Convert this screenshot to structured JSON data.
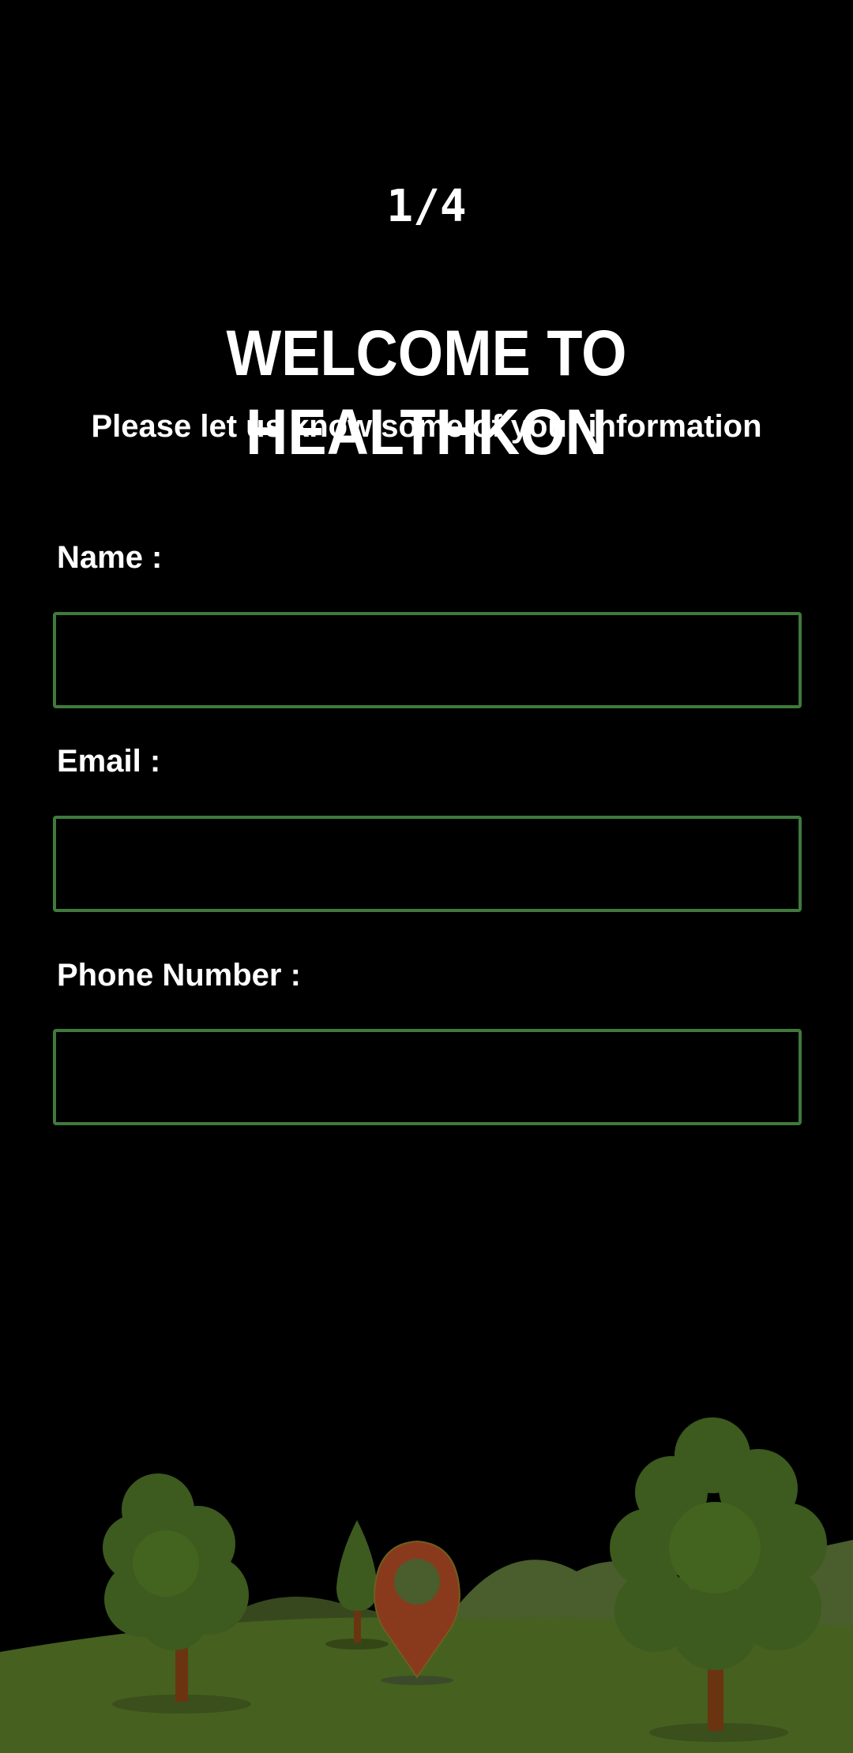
{
  "onboarding": {
    "step_indicator": "1/4",
    "title": "WELCOME TO HEALTHKON",
    "subtitle": "Please let us know some of your information"
  },
  "form": {
    "name": {
      "label": "Name :",
      "value": ""
    },
    "email": {
      "label": "Email :",
      "value": ""
    },
    "phone": {
      "label": "Phone Number :",
      "value": ""
    }
  },
  "colors": {
    "background": "#000000",
    "text": "#ffffff",
    "field_border": "#3f7a3c",
    "grass": "#46601f",
    "tree": "#3d5a1f",
    "pin": "#8a3a1c"
  }
}
